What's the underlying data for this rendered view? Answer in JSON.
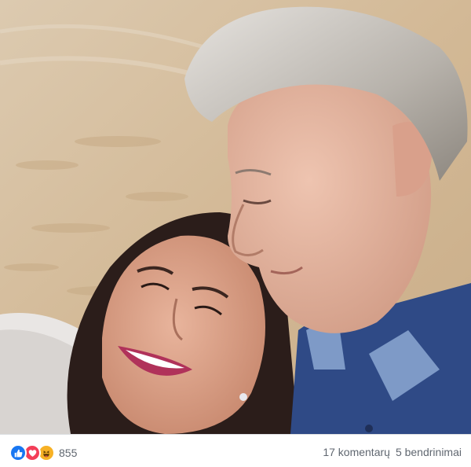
{
  "post": {
    "photo_alt": "",
    "reactions": {
      "icons": [
        "like-icon",
        "love-icon",
        "haha-icon"
      ],
      "count": "855"
    },
    "comments": "17 komentarų",
    "shares": "5 bendrinimai"
  },
  "colors": {
    "like": "#1877f2",
    "love": "#f33e58",
    "haha": "#f7b125",
    "meta_text": "#606770"
  }
}
